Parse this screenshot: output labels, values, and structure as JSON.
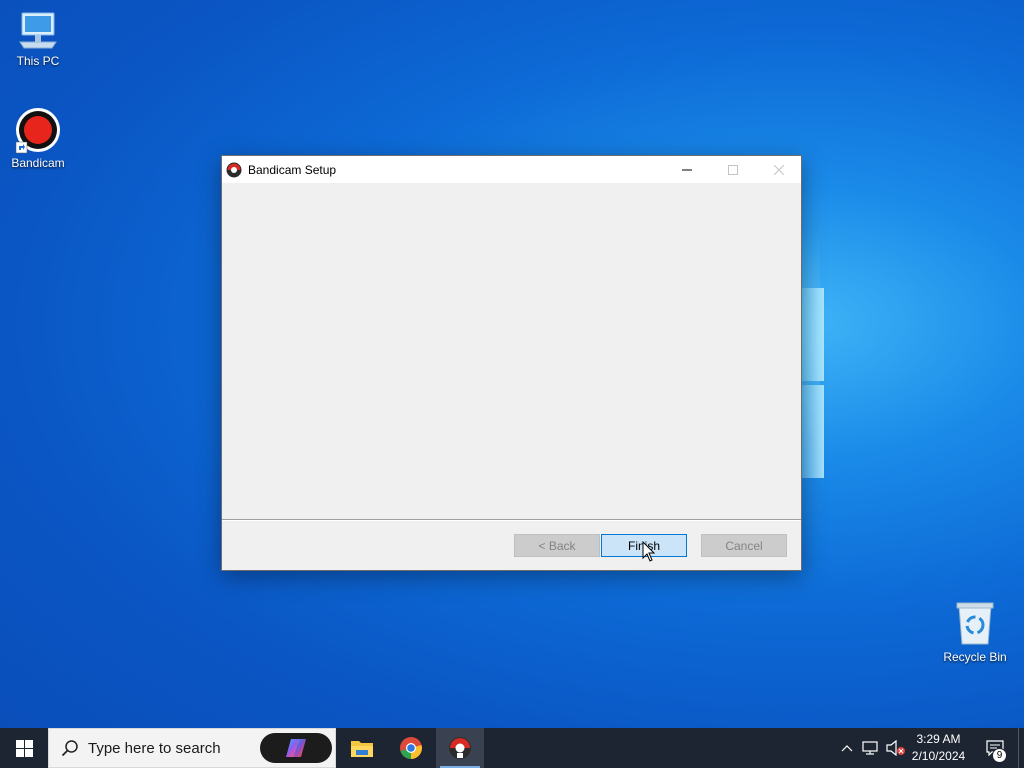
{
  "desktop": {
    "icons": [
      {
        "label": "This PC",
        "icon": "this-pc-icon"
      },
      {
        "label": "Bandicam",
        "icon": "bandicam-icon"
      },
      {
        "label": "Recycle Bin",
        "icon": "recycle-bin-icon"
      }
    ]
  },
  "dialog": {
    "title": "Bandicam Setup",
    "icon": "bandicam-setup-icon",
    "controls": {
      "minimize": "minimize-icon",
      "maximize": "maximize-icon",
      "close": "close-icon"
    },
    "buttons": {
      "back": {
        "label": "< Back",
        "enabled": false
      },
      "finish": {
        "label": "Finish",
        "enabled": true,
        "focused": true
      },
      "cancel": {
        "label": "Cancel",
        "enabled": false
      }
    }
  },
  "taskbar": {
    "search_placeholder": "Type here to search",
    "apps": [
      {
        "name": "File Explorer",
        "icon": "file-explorer-icon"
      },
      {
        "name": "Google Chrome",
        "icon": "chrome-icon"
      },
      {
        "name": "Bandicam Setup",
        "icon": "bandicam-setup-icon",
        "active": true
      }
    ],
    "clock": {
      "time": "3:29 AM",
      "date": "2/10/2024"
    },
    "notification_count": "9"
  },
  "colors": {
    "accent": "#0078d7",
    "taskbar": "#1d2533",
    "desktop": "#0a56c4"
  }
}
